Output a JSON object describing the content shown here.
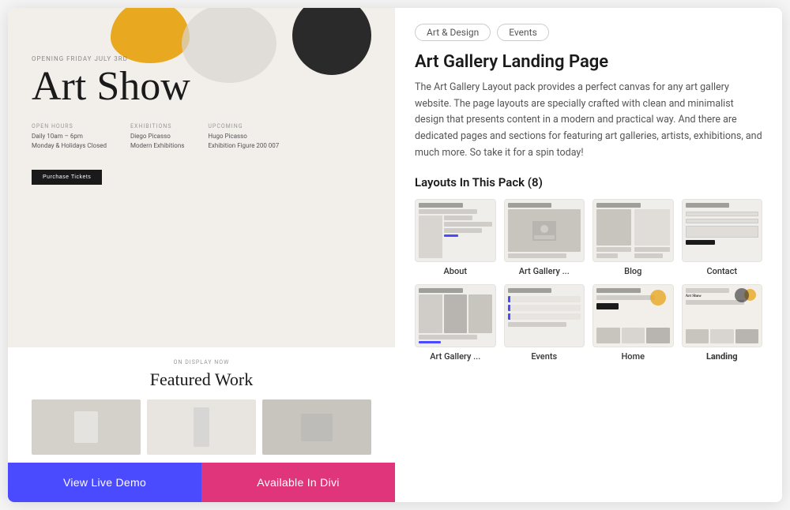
{
  "left": {
    "opening_text": "Opening Friday July 3rd",
    "title": "Art Show",
    "info_cols": [
      {
        "label": "Open Hours",
        "lines": [
          "Daily 10am – 6pm",
          "Monday & Holidays Closed"
        ]
      },
      {
        "label": "Exhibitions",
        "lines": [
          "Diego Picasso",
          "Modern Exhibitions"
        ]
      },
      {
        "label": "Upcoming",
        "lines": [
          "Hugo Picasso",
          "Exhibition Figure 200 007"
        ]
      }
    ],
    "purchase_btn": "Purchase Tickets",
    "on_display": "On Display Now",
    "featured_title": "Featured Work",
    "btn_demo": "View Live Demo",
    "btn_divi": "Available In Divi"
  },
  "right": {
    "tags": [
      "Art & Design",
      "Events"
    ],
    "title": "Art Gallery Landing Page",
    "description": "The Art Gallery Layout pack provides a perfect canvas for any art gallery website. The page layouts are specially crafted with clean and minimalist design that presents content in a modern and practical way. And there are dedicated pages and sections for featuring art galleries, artists, exhibitions, and much more. So take it for a spin today!",
    "layouts_heading": "Layouts In This Pack (8)",
    "layouts": [
      {
        "label": "About",
        "type": "about"
      },
      {
        "label": "Art Gallery ...",
        "type": "gallery"
      },
      {
        "label": "Blog",
        "type": "blog"
      },
      {
        "label": "Contact",
        "type": "contact"
      },
      {
        "label": "Art Gallery ...",
        "type": "gallery2"
      },
      {
        "label": "Events",
        "type": "events"
      },
      {
        "label": "Home",
        "type": "home"
      },
      {
        "label": "Landing",
        "type": "landing"
      }
    ]
  }
}
